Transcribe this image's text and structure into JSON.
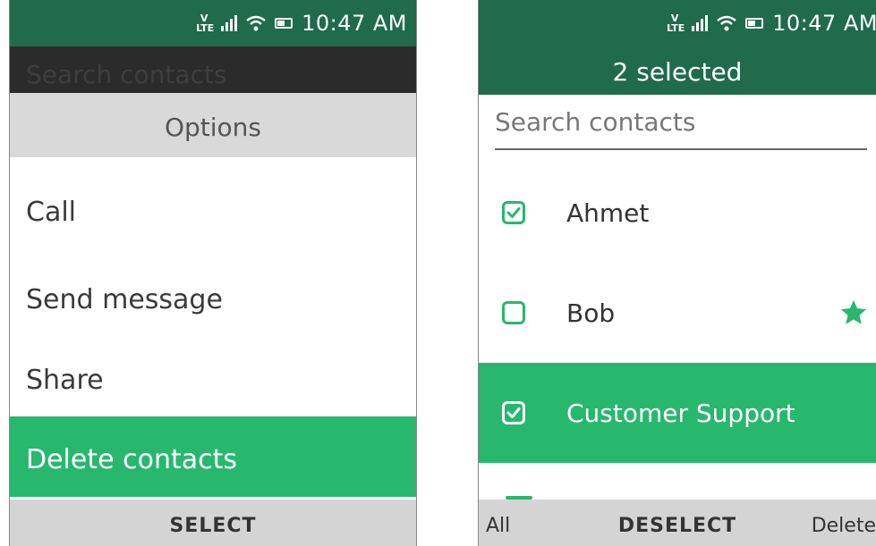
{
  "status": {
    "time": "10:47 AM",
    "lte": "LTE"
  },
  "left": {
    "search_placeholder": "Search contacts",
    "options_title": "Options",
    "menu_items": [
      "Call",
      "Send message",
      "Share",
      "Delete contacts"
    ],
    "softkey": {
      "center": "SELECT"
    }
  },
  "right": {
    "header": "2 selected",
    "search_placeholder": "Search contacts",
    "contacts": [
      {
        "name": "Ahmet",
        "checked": true,
        "favorite": false
      },
      {
        "name": "Bob",
        "checked": false,
        "favorite": true
      },
      {
        "name": "Customer Support",
        "checked": true,
        "favorite": false,
        "highlighted": true
      }
    ],
    "softkey": {
      "left": "All",
      "center": "DESELECT",
      "right": "Delete"
    }
  },
  "colors": {
    "header": "#1f6b4c",
    "accent": "#27b86d",
    "softkey_bg": "#d4d4d4"
  },
  "icons": [
    "lte-icon",
    "signal-icon",
    "wifi-icon",
    "battery-icon",
    "check-icon",
    "star-icon"
  ]
}
